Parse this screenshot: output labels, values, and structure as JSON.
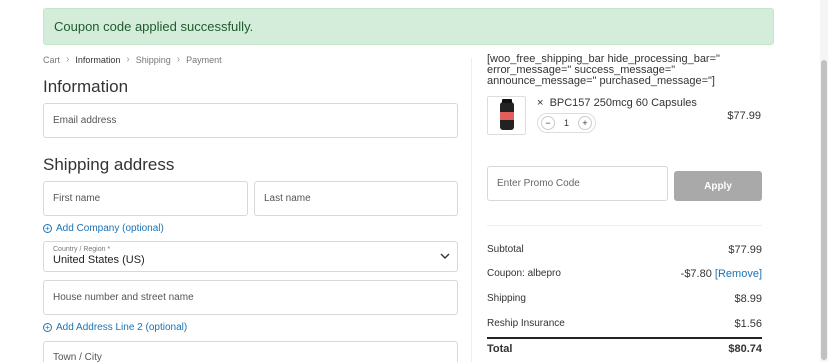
{
  "notice": {
    "text": "Coupon code applied successfully."
  },
  "breadcrumb": {
    "cart": "Cart",
    "information": "Information",
    "shipping": "Shipping",
    "payment": "Payment"
  },
  "information": {
    "heading": "Information",
    "email_placeholder": "Email address"
  },
  "shipping_address": {
    "heading": "Shipping address",
    "first_name_placeholder": "First name",
    "last_name_placeholder": "Last name",
    "add_company": "Add Company (optional)",
    "country_label": "Country / Region *",
    "country_value": "United States (US)",
    "street_placeholder": "House number and street name",
    "add_address_line2": "Add Address Line 2 (optional)",
    "city_placeholder": "Town / City"
  },
  "sidebar": {
    "shortcode": "[woo_free_shipping_bar hide_processing_bar=\" error_message=\" success_message=\" announce_message=\" purchased_message=\"]",
    "product": {
      "remove_symbol": "×",
      "name": "BPC157 250mcg 60 Capsules",
      "quantity": "1",
      "price": "$77.99"
    },
    "promo_placeholder": "Enter Promo Code",
    "apply_label": "Apply",
    "summary": {
      "subtotal_label": "Subtotal",
      "subtotal_value": "$77.99",
      "coupon_label": "Coupon: albepro",
      "coupon_value": "-$7.80",
      "coupon_remove": "[Remove]",
      "shipping_label": "Shipping",
      "shipping_value": "$8.99",
      "reship_label": "Reship Insurance",
      "reship_value": "$1.56",
      "total_label": "Total",
      "total_value": "$80.74"
    }
  },
  "colors": {
    "notice_bg": "#d4edda",
    "link": "#1a73b5",
    "apply_bg": "#a9a9a9"
  }
}
